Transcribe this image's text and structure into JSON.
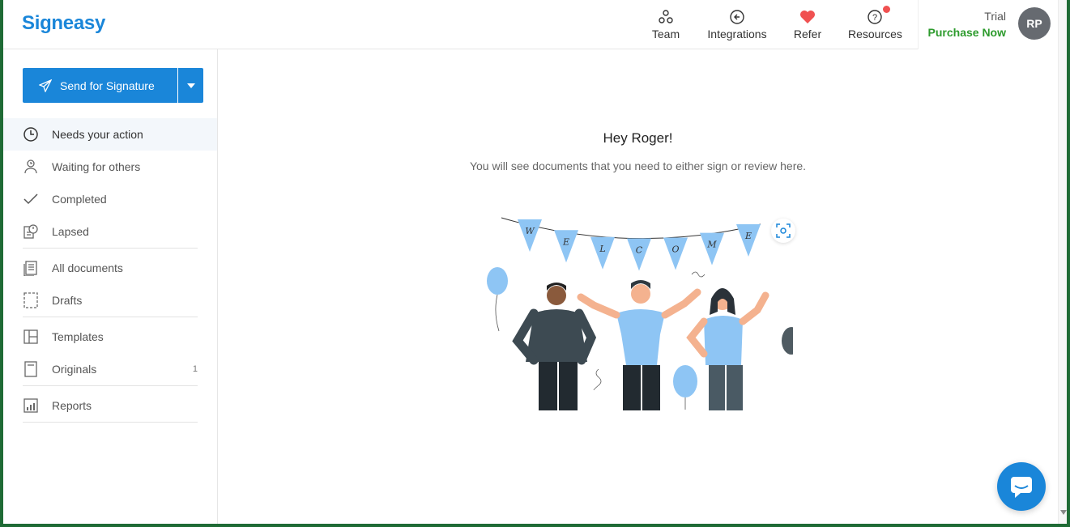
{
  "header": {
    "logo": "Signeasy",
    "nav": {
      "team": "Team",
      "integrations": "Integrations",
      "refer": "Refer",
      "resources": "Resources"
    },
    "account": {
      "plan": "Trial",
      "purchase": "Purchase Now",
      "initials": "RP"
    }
  },
  "sidebar": {
    "send_label": "Send for Signature",
    "items": {
      "needs_action": "Needs your action",
      "waiting": "Waiting for others",
      "completed": "Completed",
      "lapsed": "Lapsed",
      "all_documents": "All documents",
      "drafts": "Drafts",
      "templates": "Templates",
      "originals": "Originals",
      "originals_count": "1",
      "reports": "Reports"
    }
  },
  "main": {
    "greeting": "Hey Roger!",
    "subtitle": "You will see documents that you need to either sign or review here.",
    "banner_letters": [
      "W",
      "E",
      "L",
      "C",
      "O",
      "M",
      "E"
    ]
  },
  "colors": {
    "brand": "#1a86d9",
    "purchase": "#2d9b2d",
    "alert_dot": "#f05151",
    "illustration_blue": "#8ec5f4"
  }
}
